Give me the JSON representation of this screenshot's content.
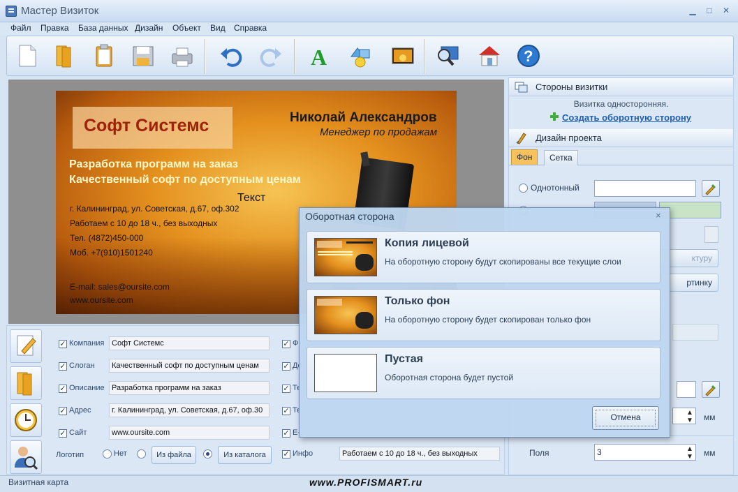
{
  "window": {
    "title": "Мастер Визиток",
    "minimize": "▁",
    "maximize": "□",
    "close": "✕"
  },
  "menu": [
    "Файл",
    "Правка",
    "База данных",
    "Дизайн",
    "Объект",
    "Вид",
    "Справка"
  ],
  "toolbar_icons": [
    "new-file-icon",
    "open-folder-icon",
    "clipboard-icon",
    "save-icon",
    "print-icon",
    "undo-icon",
    "redo-icon",
    "text-tool-icon",
    "shape-tool-icon",
    "image-tool-icon",
    "zoom-icon",
    "home-icon",
    "help-icon"
  ],
  "card": {
    "company": "Софт Системс",
    "person": "Николай Александров",
    "position": "Менеджер по продажам",
    "slogan1": "Разработка программ на заказ",
    "slogan2": "Качественный софт по доступным ценам",
    "text_label": "Текст",
    "address": "г. Калининград, ул. Советская, д.67, оф.302",
    "hours": "Работаем с 10 до 18 ч., без выходных",
    "phone": "Тел. (4872)450-000",
    "mobile": "Моб. +7(910)1501240",
    "email": "E-mail: sales@oursite.com",
    "site": "www.oursite.com"
  },
  "properties": {
    "company_label": "Компания",
    "company_value": "Софт Системс",
    "slogan_label": "Слоган",
    "slogan_value": "Качественный софт по доступным ценам",
    "description_label": "Описание",
    "description_value": "Разработка программ на заказ",
    "address_label": "Адрес",
    "address_value": "г. Калининград, ул. Советская, д.67, оф.30",
    "site_label": "Сайт",
    "site_value": "www.oursite.com",
    "logo_label": "Логотип",
    "logo_none": "Нет",
    "logo_file": "Из файла",
    "logo_catalog": "Из каталога",
    "col2_f": "Ф",
    "col2_d": "До",
    "col2_t1": "Те",
    "col2_t2": "Те",
    "col2_e": "E-",
    "info_label": "Инфо",
    "info_value": "Работаем с 10 до 18 ч., без выходных"
  },
  "right_panel": {
    "sides_header": "Стороны визитки",
    "sides_status": "Визитка односторонняя.",
    "create_back_link": "Создать оборотную сторону",
    "design_header": "Дизайн проекта",
    "tab_background": "Фон",
    "tab_grid": "Сетка",
    "solid_label": "Однотонный",
    "texture_button": "ктуру",
    "picture_button": "ртинку",
    "unit1": "мм",
    "margins_label": "Поля",
    "margins_value": "3",
    "unit2": "мм",
    "colors": {
      "solid": "#ffffff",
      "gradient1": "#b9cde6",
      "gradient2": "#c8e3c6"
    }
  },
  "dialog": {
    "title": "Оборотная сторона",
    "close": "×",
    "options": [
      {
        "title": "Копия лицевой",
        "desc": "На оборотную сторону будут скопированы все текущие слои"
      },
      {
        "title": "Только фон",
        "desc": "На оборотную сторону будет скопирован только фон"
      },
      {
        "title": "Пустая",
        "desc": "Оборотная сторона будет пустой"
      }
    ],
    "cancel": "Отмена"
  },
  "status": {
    "text": "Визитная карта",
    "watermark": "www.PROFISMART.ru"
  }
}
